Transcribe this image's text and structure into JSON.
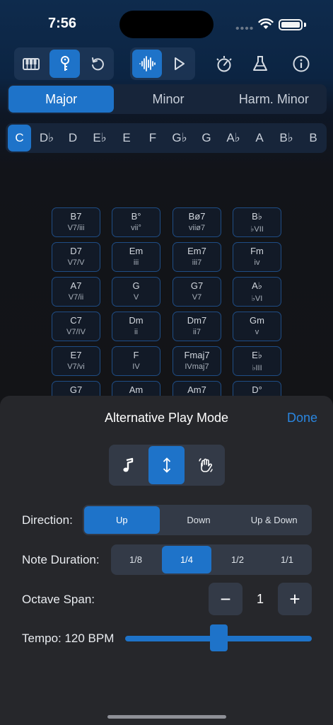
{
  "status_bar": {
    "time": "7:56",
    "dots": "••••"
  },
  "toolbar": {
    "groups": [
      {
        "buttons": [
          {
            "icon": "piano-keys-icon",
            "active": false
          },
          {
            "icon": "key-icon",
            "active": true
          },
          {
            "icon": "reset-icon",
            "active": false
          }
        ]
      },
      {
        "buttons": [
          {
            "icon": "waveform-icon",
            "active": true
          },
          {
            "icon": "play-icon",
            "active": false
          }
        ]
      }
    ],
    "extra": [
      "metronome-icon",
      "flask-icon",
      "info-icon"
    ],
    "accent": "#1e73c9"
  },
  "scale_modes": {
    "items": [
      "Major",
      "Minor",
      "Harm. Minor"
    ],
    "selected": "Major"
  },
  "keys": {
    "items": [
      "C",
      "D♭",
      "D",
      "E♭",
      "E",
      "F",
      "G♭",
      "G",
      "A♭",
      "A",
      "B♭",
      "B"
    ],
    "selected": "C"
  },
  "chords": [
    [
      {
        "name": "B7",
        "roman": "V7/iii"
      },
      {
        "name": "B°",
        "roman": "vii°"
      },
      {
        "name": "Bø7",
        "roman": "viiø7"
      },
      {
        "name": "B♭",
        "roman": "♭VII"
      }
    ],
    [
      {
        "name": "D7",
        "roman": "V7/V"
      },
      {
        "name": "Em",
        "roman": "iii"
      },
      {
        "name": "Em7",
        "roman": "iii7"
      },
      {
        "name": "Fm",
        "roman": "iv"
      }
    ],
    [
      {
        "name": "A7",
        "roman": "V7/ii"
      },
      {
        "name": "G",
        "roman": "V"
      },
      {
        "name": "G7",
        "roman": "V7"
      },
      {
        "name": "A♭",
        "roman": "♭VI"
      }
    ],
    [
      {
        "name": "C7",
        "roman": "V7/IV"
      },
      {
        "name": "Dm",
        "roman": "ii"
      },
      {
        "name": "Dm7",
        "roman": "ii7"
      },
      {
        "name": "Gm",
        "roman": "v"
      }
    ],
    [
      {
        "name": "E7",
        "roman": "V7/vi"
      },
      {
        "name": "F",
        "roman": "IV"
      },
      {
        "name": "Fmaj7",
        "roman": "IVmaj7"
      },
      {
        "name": "E♭",
        "roman": "♭III"
      }
    ],
    [
      {
        "name": "G7",
        "roman": ""
      },
      {
        "name": "Am",
        "roman": ""
      },
      {
        "name": "Am7",
        "roman": ""
      },
      {
        "name": "D°",
        "roman": ""
      }
    ]
  ],
  "sheet": {
    "title": "Alternative Play Mode",
    "done_label": "Done",
    "play_modes": {
      "items": [
        "note-icon",
        "arrows-up-down-icon",
        "hand-wave-icon"
      ],
      "selected": 1
    },
    "direction": {
      "label": "Direction:",
      "options": [
        "Up",
        "Down",
        "Up & Down"
      ],
      "selected": "Up"
    },
    "note_duration": {
      "label": "Note Duration:",
      "options": [
        "1/8",
        "1/4",
        "1/2",
        "1/1"
      ],
      "selected": "1/4"
    },
    "octave_span": {
      "label": "Octave Span:",
      "value": "1",
      "minus": "−",
      "plus": "+"
    },
    "tempo": {
      "label": "Tempo: 120 BPM",
      "value": 120,
      "min": 40,
      "max": 200
    }
  }
}
